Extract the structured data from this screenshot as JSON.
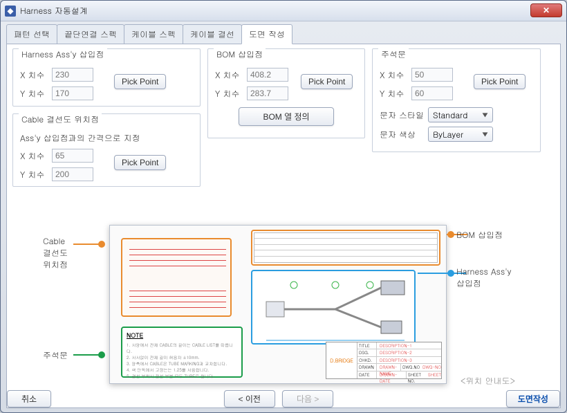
{
  "window": {
    "title": "Harness 자동설계"
  },
  "tabs": [
    "패턴 선택",
    "끝단연결 스펙",
    "케이블 스펙",
    "케이블 결선",
    "도면 작성"
  ],
  "active_tab": 4,
  "group_harness": {
    "legend": "Harness Ass'y 삽입점",
    "x_label": "X 치수",
    "y_label": "Y 치수",
    "x_value": "230",
    "y_value": "170",
    "pick": "Pick Point"
  },
  "group_cable": {
    "legend": "Cable 결선도 위치점",
    "subhead": "Ass'y 삽입점과의 간격으로 지정",
    "x_label": "X 치수",
    "y_label": "Y 치수",
    "x_value": "65",
    "y_value": "200",
    "pick": "Pick Point"
  },
  "group_bom": {
    "legend": "BOM 삽입점",
    "x_label": "X 치수",
    "y_label": "Y 치수",
    "x_value": "408.2",
    "y_value": "283.7",
    "pick": "Pick Point",
    "bom_cols": "BOM 열 정의"
  },
  "group_annot": {
    "legend": "주석문",
    "x_label": "X 치수",
    "y_label": "Y 치수",
    "x_value": "50",
    "y_value": "60",
    "pick": "Pick Point",
    "style_label": "문자 스타일",
    "style_value": "Standard",
    "color_label": "문자 색상",
    "color_value": "ByLayer"
  },
  "callouts": {
    "cable": "Cable\n결선도\n위치점",
    "annot": "주석문",
    "bom": "BOM 삽입점",
    "harness": "Harness Ass'y\n삽입점",
    "guide": "<위치 안내도>",
    "note_title": "NOTE",
    "titleblock": {
      "header": "D.BRIDGE",
      "row_labels": [
        "TITLE",
        "DSG.",
        "CHKD.",
        "DRAWN",
        "DATE"
      ],
      "values": [
        "DESCRIPTION-1",
        "DESCRIPTION-2",
        "DESCRIPTION-3",
        "DRAWN-NAME",
        "DRAWN-DATE"
      ],
      "extra_labels": [
        "DWG.NO",
        "SHEET NO."
      ],
      "extra_values": [
        "DWG-NO",
        "SHEET"
      ]
    }
  },
  "buttons": {
    "cancel": "취소",
    "prev": "< 이전",
    "next": "다음 >",
    "create": "도면작성"
  }
}
